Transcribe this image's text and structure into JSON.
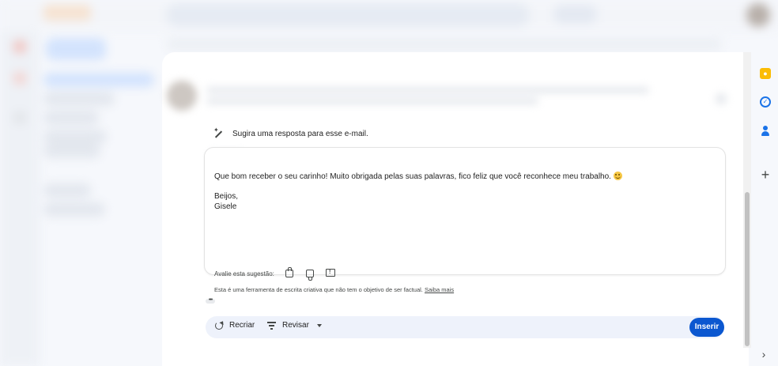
{
  "assistant": {
    "prompt": "Sugira uma resposta para esse e-mail."
  },
  "suggestion": {
    "body_line": "Que bom receber o seu carinho! Muito obrigada pelas suas palavras, fico feliz que você reconhece meu trabalho.",
    "closing": "Beijos,",
    "signature": "Gisele"
  },
  "rating": {
    "label": "Avalie esta sugestão:"
  },
  "disclaimer": {
    "text": "Esta é uma ferramenta de escrita criativa que não tem o objetivo de ser factual.",
    "link": "Saiba mais"
  },
  "actions": {
    "recreate": "Recriar",
    "revise": "Revisar",
    "insert": "Inserir"
  },
  "colors": {
    "primary": "#0b57d0",
    "action_bar": "#eef2fb",
    "keep": "#fbbc04",
    "tasks": "#1a73e8"
  },
  "icons": [
    "magic-wand-icon",
    "smile-emoji-icon",
    "thumbs-up-icon",
    "thumbs-down-icon",
    "report-icon",
    "refresh-icon",
    "filter-icon",
    "caret-down-icon",
    "keep-icon",
    "tasks-icon",
    "contacts-icon",
    "plus-icon",
    "chevron-right-icon"
  ]
}
